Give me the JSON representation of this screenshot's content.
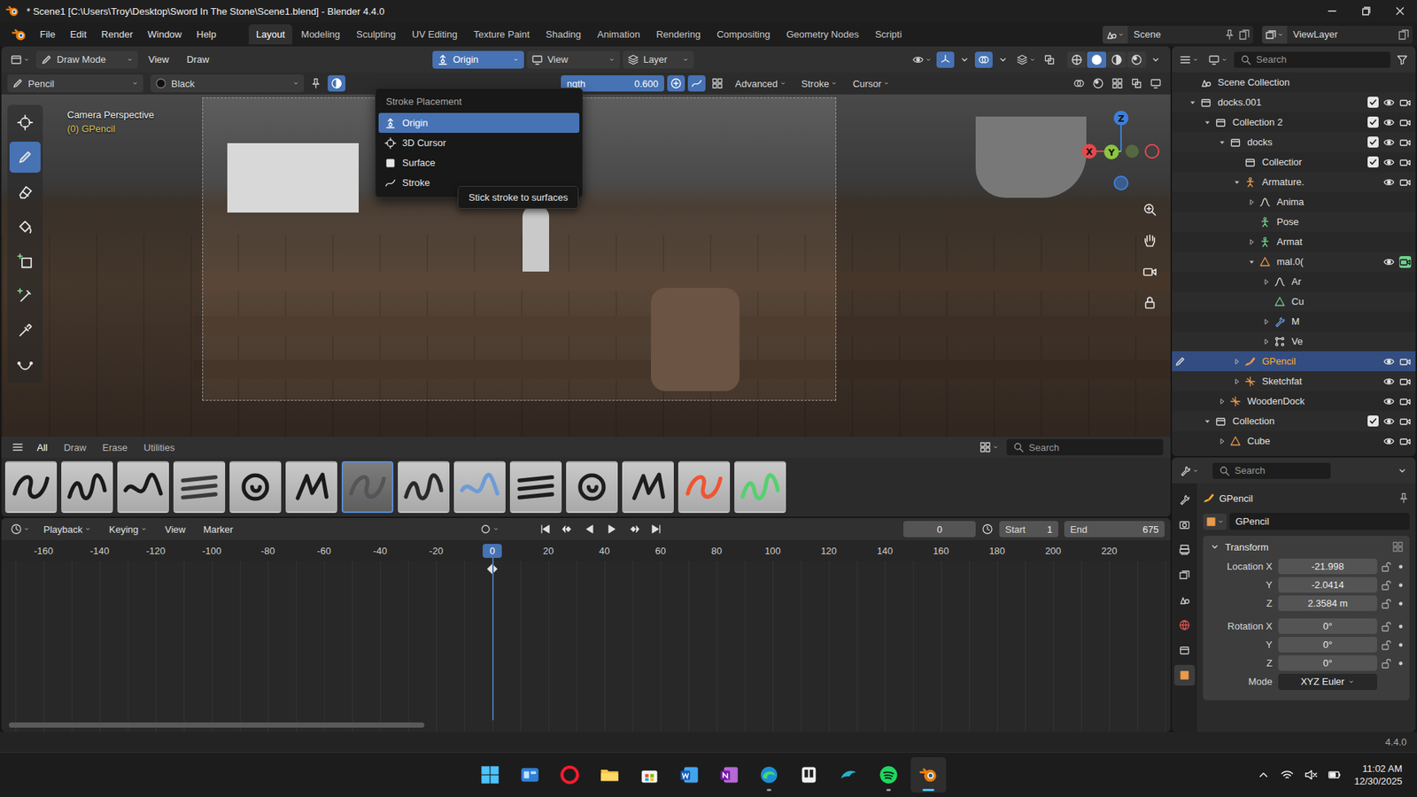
{
  "window": {
    "title": "* Scene1 [C:\\Users\\Troy\\Desktop\\Sword In The Stone\\Scene1.blend] - Blender 4.4.0"
  },
  "menus": [
    "File",
    "Edit",
    "Render",
    "Window",
    "Help"
  ],
  "workspaces": [
    {
      "label": "Layout",
      "selected": true
    },
    {
      "label": "Modeling",
      "selected": false
    },
    {
      "label": "Sculpting",
      "selected": false
    },
    {
      "label": "UV Editing",
      "selected": false
    },
    {
      "label": "Texture Paint",
      "selected": false
    },
    {
      "label": "Shading",
      "selected": false
    },
    {
      "label": "Animation",
      "selected": false
    },
    {
      "label": "Rendering",
      "selected": false
    },
    {
      "label": "Compositing",
      "selected": false
    },
    {
      "label": "Geometry Nodes",
      "selected": false
    },
    {
      "label": "Scripti",
      "selected": false
    }
  ],
  "scene": "Scene",
  "view_layer": "ViewLayer",
  "viewport_header": {
    "mode": "Draw Mode",
    "menus": [
      "View",
      "Draw"
    ],
    "placement": {
      "label": "Origin",
      "open": true
    },
    "orientation": "View",
    "layer": "Layer",
    "shading": [
      {
        "kind": "wire",
        "selected": false
      },
      {
        "kind": "solid",
        "selected": true
      },
      {
        "kind": "material",
        "selected": false
      },
      {
        "kind": "rendered",
        "selected": false
      }
    ]
  },
  "tool_settings": {
    "brush": "Pencil",
    "material": "Black",
    "strength_label": "ngth",
    "strength": "0.600",
    "popovers": [
      "Advanced",
      "Stroke",
      "Cursor"
    ]
  },
  "viewport": {
    "camera": "Camera Perspective",
    "object": "(0) GPencil",
    "tools": [
      {
        "kind": "cursor",
        "selected": false
      },
      {
        "kind": "draw",
        "selected": true
      },
      {
        "kind": "erase",
        "selected": false
      },
      {
        "kind": "fill",
        "selected": false
      },
      {
        "kind": "box",
        "selected": false
      },
      {
        "kind": "tint",
        "selected": false
      },
      {
        "kind": "eyedropper",
        "selected": false
      },
      {
        "kind": "curve",
        "selected": false
      }
    ],
    "gizmo": [
      {
        "axis": "X",
        "color": "#e5484d"
      },
      {
        "axis": "Y",
        "color": "#8cc63f"
      },
      {
        "axis": "Z",
        "color": "#3d7fdc"
      }
    ]
  },
  "placement_menu": {
    "title": "Stroke Placement",
    "items": [
      {
        "label": "Origin",
        "kind": "origin",
        "selected": true
      },
      {
        "label": "3D Cursor",
        "kind": "cursor3d",
        "selected": false
      },
      {
        "label": "Surface",
        "kind": "surface",
        "selected": false
      },
      {
        "label": "Stroke",
        "kind": "stroke",
        "selected": false
      }
    ],
    "tooltip": "Stick stroke to surfaces"
  },
  "asset_shelf": {
    "tabs": [
      {
        "label": "All",
        "selected": true
      },
      {
        "label": "Draw",
        "selected": false
      },
      {
        "label": "Erase",
        "selected": false
      },
      {
        "label": "Utilities",
        "selected": false
      }
    ],
    "search": "Search",
    "brushes": [
      {
        "color": "#1a1a1a",
        "selected": false
      },
      {
        "color": "#1a1a1a",
        "selected": false
      },
      {
        "color": "#1a1a1a",
        "selected": false
      },
      {
        "color": "#3a3a3a",
        "selected": false
      },
      {
        "color": "#1a1a1a",
        "selected": false
      },
      {
        "color": "#1a1a1a",
        "selected": false
      },
      {
        "color": "#555555",
        "selected": true
      },
      {
        "color": "#2a2a2a",
        "selected": false
      },
      {
        "color": "#6f9bd6",
        "selected": false
      },
      {
        "color": "#1e1e1e",
        "selected": false
      },
      {
        "color": "#1e1e1e",
        "selected": false
      },
      {
        "color": "#1e1e1e",
        "selected": false
      },
      {
        "color": "#ee5533",
        "selected": false
      },
      {
        "color": "#55d070",
        "selected": false
      }
    ]
  },
  "timeline": {
    "menus": [
      "Playback",
      "Keying",
      "View",
      "Marker"
    ],
    "frame": "0",
    "start_label": "Start",
    "start": "1",
    "end_label": "End",
    "end": "675",
    "ticks": [
      "-160",
      "-140",
      "-120",
      "-100",
      "-80",
      "-60",
      "-40",
      "-20",
      "0",
      "20",
      "40",
      "60",
      "80",
      "100",
      "120",
      "140",
      "160",
      "180",
      "200",
      "220"
    ],
    "playhead": "0",
    "keyframes": [
      "0"
    ],
    "scrollbar_level": 0.36
  },
  "outliner": {
    "search": "Search",
    "items": [
      {
        "label": "Scene Collection",
        "kind": "scene",
        "depth": 0,
        "has_children": false,
        "expanded": false,
        "excludable": false,
        "checked": false,
        "toggles": false,
        "visible": true,
        "render_highlight": false,
        "editing": false,
        "selected": false
      },
      {
        "label": "docks.001",
        "kind": "collection",
        "depth": 0,
        "has_children": true,
        "expanded": true,
        "excludable": true,
        "checked": true,
        "toggles": true,
        "visible": true,
        "render_highlight": false,
        "editing": false,
        "selected": false
      },
      {
        "label": "Collection 2",
        "kind": "collection",
        "depth": 1,
        "has_children": true,
        "expanded": true,
        "excludable": true,
        "checked": true,
        "toggles": true,
        "visible": true,
        "render_highlight": false,
        "editing": false,
        "selected": false
      },
      {
        "label": "docks",
        "kind": "collection",
        "depth": 2,
        "has_children": true,
        "expanded": true,
        "excludable": true,
        "checked": true,
        "toggles": true,
        "visible": true,
        "render_highlight": false,
        "editing": false,
        "selected": false
      },
      {
        "label": "Collectior",
        "kind": "collection",
        "depth": 3,
        "has_children": false,
        "expanded": false,
        "excludable": true,
        "checked": true,
        "toggles": true,
        "visible": true,
        "render_highlight": false,
        "editing": false,
        "selected": false
      },
      {
        "label": "Armature.",
        "kind": "armature",
        "depth": 3,
        "has_children": true,
        "expanded": true,
        "excludable": false,
        "checked": false,
        "toggles": true,
        "visible": true,
        "render_highlight": false,
        "editing": false,
        "selected": false
      },
      {
        "label": "Anima",
        "kind": "action",
        "depth": 4,
        "has_children": true,
        "expanded": false,
        "excludable": false,
        "checked": false,
        "toggles": false,
        "visible": true,
        "render_highlight": false,
        "editing": false,
        "selected": false
      },
      {
        "label": "Pose",
        "kind": "pose",
        "depth": 4,
        "has_children": false,
        "expanded": false,
        "excludable": false,
        "checked": false,
        "toggles": false,
        "visible": true,
        "render_highlight": false,
        "editing": false,
        "selected": false
      },
      {
        "label": "Armat",
        "kind": "pose",
        "depth": 4,
        "has_children": true,
        "expanded": false,
        "excludable": false,
        "checked": false,
        "toggles": false,
        "visible": true,
        "render_highlight": false,
        "editing": false,
        "selected": false
      },
      {
        "label": "mal.0(",
        "kind": "mesh",
        "depth": 4,
        "has_children": true,
        "expanded": true,
        "excludable": false,
        "checked": false,
        "toggles": true,
        "visible": true,
        "render_highlight": true,
        "editing": false,
        "selected": false
      },
      {
        "label": "Ar",
        "kind": "action",
        "depth": 5,
        "has_children": true,
        "expanded": false,
        "excludable": false,
        "checked": false,
        "toggles": false,
        "visible": true,
        "render_highlight": false,
        "editing": false,
        "selected": false
      },
      {
        "label": "Cu",
        "kind": "meshdata",
        "depth": 5,
        "has_children": false,
        "expanded": false,
        "excludable": false,
        "checked": false,
        "toggles": false,
        "visible": true,
        "render_highlight": false,
        "editing": false,
        "selected": false
      },
      {
        "label": "M",
        "kind": "modifier",
        "depth": 5,
        "has_children": true,
        "expanded": false,
        "excludable": false,
        "checked": false,
        "toggles": false,
        "visible": true,
        "render_highlight": false,
        "editing": false,
        "selected": false
      },
      {
        "label": "Ve",
        "kind": "vgroup",
        "depth": 5,
        "has_children": true,
        "expanded": false,
        "excludable": false,
        "checked": false,
        "toggles": false,
        "visible": true,
        "render_highlight": false,
        "editing": false,
        "selected": false
      },
      {
        "label": "GPencil",
        "kind": "gpencil",
        "depth": 3,
        "has_children": true,
        "expanded": false,
        "excludable": false,
        "checked": false,
        "toggles": true,
        "visible": true,
        "render_highlight": false,
        "editing": true,
        "selected": true
      },
      {
        "label": "Sketchfat",
        "kind": "empty",
        "depth": 3,
        "has_children": true,
        "expanded": false,
        "excludable": false,
        "checked": false,
        "toggles": true,
        "visible": true,
        "render_highlight": false,
        "editing": false,
        "selected": false
      },
      {
        "label": "WoodenDock",
        "kind": "empty",
        "depth": 2,
        "has_children": true,
        "expanded": false,
        "excludable": false,
        "checked": false,
        "toggles": true,
        "visible": true,
        "render_highlight": false,
        "editing": false,
        "selected": false
      },
      {
        "label": "Collection",
        "kind": "collection",
        "depth": 1,
        "has_children": true,
        "expanded": true,
        "excludable": true,
        "checked": true,
        "toggles": true,
        "visible": true,
        "render_highlight": false,
        "editing": false,
        "selected": false
      },
      {
        "label": "Cube",
        "kind": "mesh",
        "depth": 2,
        "has_children": true,
        "expanded": false,
        "excludable": false,
        "checked": false,
        "toggles": true,
        "visible": true,
        "render_highlight": false,
        "editing": false,
        "selected": false
      }
    ]
  },
  "properties": {
    "search": "Search",
    "context": "GPencil",
    "object_name": "GPencil",
    "panel": "Transform",
    "tabs": [
      {
        "kind": "tool",
        "selected": false
      },
      {
        "kind": "render",
        "selected": false
      },
      {
        "kind": "output",
        "selected": false
      },
      {
        "kind": "viewlayer",
        "selected": false
      },
      {
        "kind": "scenetab",
        "selected": false
      },
      {
        "kind": "world",
        "selected": false
      },
      {
        "kind": "collectiontab",
        "selected": false
      },
      {
        "kind": "object",
        "selected": true
      }
    ],
    "location": [
      {
        "label": "Location X",
        "value": "-21.998"
      },
      {
        "label": "Y",
        "value": "-2.0414"
      },
      {
        "label": "Z",
        "value": "2.3584 m"
      }
    ],
    "rotation": [
      {
        "label": "Rotation X",
        "value": "0°"
      },
      {
        "label": "Y",
        "value": "0°"
      },
      {
        "label": "Z",
        "value": "0°"
      }
    ],
    "mode_label": "Mode",
    "mode": "XYZ Euler"
  },
  "status_bar": {
    "version": "4.4.0"
  },
  "taskbar": {
    "apps": [
      {
        "kind": "start",
        "running": false,
        "selected": false
      },
      {
        "kind": "widgets",
        "running": false,
        "selected": false
      },
      {
        "kind": "opera",
        "running": false,
        "selected": false
      },
      {
        "kind": "explorer",
        "running": false,
        "selected": false
      },
      {
        "kind": "store",
        "running": false,
        "selected": false
      },
      {
        "kind": "word",
        "running": false,
        "selected": false
      },
      {
        "kind": "onenote",
        "running": false,
        "selected": false
      },
      {
        "kind": "edge",
        "running": true,
        "selected": false
      },
      {
        "kind": "notes",
        "running": false,
        "selected": false
      },
      {
        "kind": "dolphin",
        "running": false,
        "selected": false
      },
      {
        "kind": "spotify",
        "running": true,
        "selected": false
      },
      {
        "kind": "blender",
        "running": true,
        "selected": true
      }
    ],
    "time": "11:02 AM",
    "date": "12/30/2025"
  }
}
